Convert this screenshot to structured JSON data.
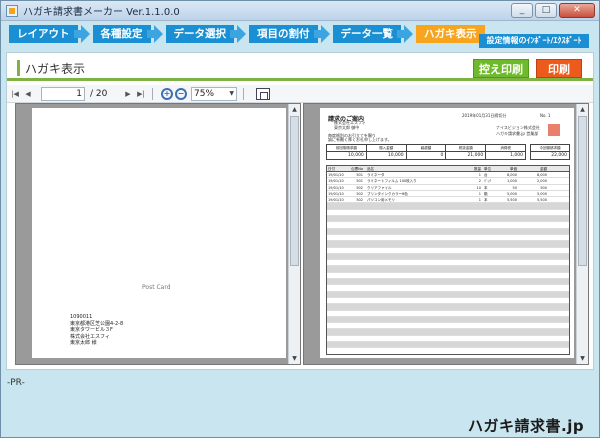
{
  "window": {
    "title": "ハガキ請求書メーカー Ver.1.1.0.0",
    "controls": [
      "_",
      "□",
      "✕"
    ]
  },
  "steps": [
    {
      "label": "レイアウト",
      "active": false
    },
    {
      "label": "各種設定",
      "active": false
    },
    {
      "label": "データ選択",
      "active": false
    },
    {
      "label": "項目の割付",
      "active": false
    },
    {
      "label": "データ一覧",
      "active": false
    },
    {
      "label": "ハガキ表示",
      "active": true
    }
  ],
  "setting_export_label": "設定情報のｲﾝﾎﾟｰﾄ/ｴｸｽﾎﾟｰﾄ",
  "section_title": "ハガキ表示",
  "actions": {
    "copy_print": "控え印刷",
    "print": "印刷"
  },
  "toolbar": {
    "nav_icons": [
      "first-page-icon",
      "prev-page-icon",
      "next-page-icon",
      "last-page-icon"
    ],
    "page_current": "1",
    "page_total": "/ 20",
    "zoom": "75%"
  },
  "left_preview": {
    "postcard_label": "Post Card",
    "address_lines": [
      "1090011",
      "東京都港区芝公園4-2-8",
      "東京タワービル３F",
      "株式会社エスフィ",
      "東京太郎 様"
    ]
  },
  "right_preview": {
    "title": "請求のご案内",
    "company_lines": [
      "株式会社エスフィ",
      "東京太郎 御中"
    ],
    "date": "2019年01月31日締切分",
    "page_no": "No. 1",
    "note_lines": [
      "毎度格別のお引立てを賜り",
      "誠に有難く厚くお礼申し上げます。"
    ],
    "sender_lines": [
      "ナイスビジョン株式会社",
      "ハガキ請求書.jp 営業部"
    ],
    "summary_headers": [
      "前回御請求額",
      "御入金額",
      "繰越額",
      "税抜金額",
      "消費税",
      "今回御請求額"
    ],
    "summary_values": [
      "10,000",
      "10,000",
      "0",
      "21,000",
      "1,000",
      "22,000"
    ],
    "table_headers": [
      "日付",
      "伝票No",
      "品名",
      "数量",
      "単位",
      "単価",
      "金額"
    ],
    "rows": [
      [
        "19/01/10",
        "501",
        "ラミネータ",
        "1",
        "台",
        "8,000",
        "8,000"
      ],
      [
        "19/01/10",
        "501",
        "ラミネートフィルム 100枚入り",
        "2",
        "ﾊﾟｯｸ",
        "1,000",
        "2,000"
      ],
      [
        "19/01/10",
        "502",
        "クリアファイル",
        "10",
        "本",
        "50",
        "500"
      ],
      [
        "19/01/10",
        "502",
        "プリンタインクカラー6色",
        "1",
        "箱",
        "5,000",
        "5,000"
      ],
      [
        "19/01/10",
        "502",
        "パソコン用メモリ",
        "1",
        "本",
        "5,500",
        "5,500"
      ]
    ]
  },
  "status_text": "-PR-",
  "brand": "ハガキ請求書.jp"
}
